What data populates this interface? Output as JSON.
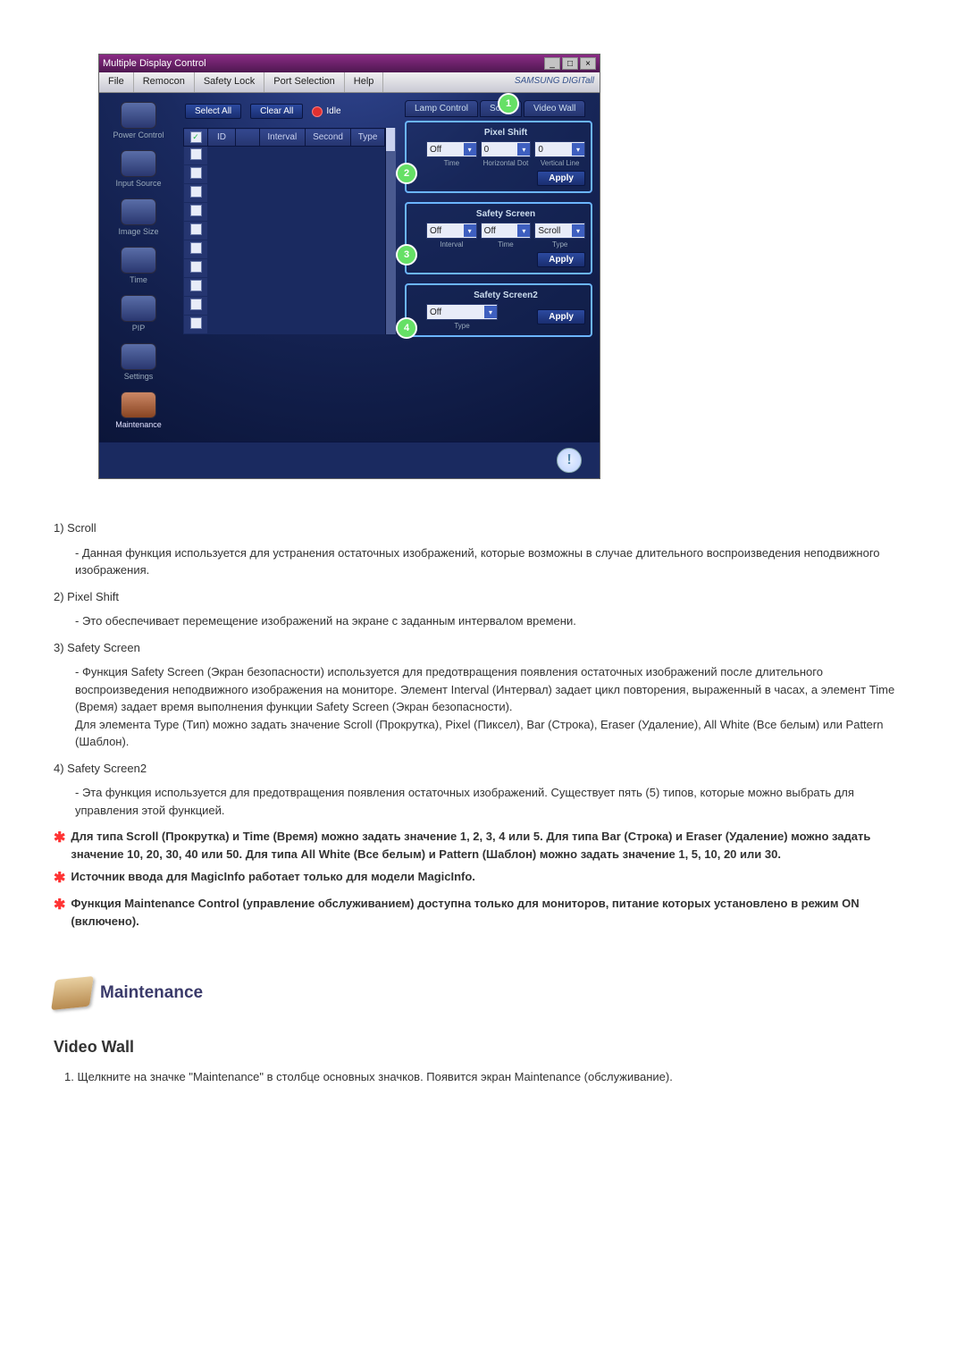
{
  "app": {
    "window_title": "Multiple Display Control",
    "menu": [
      "File",
      "Remocon",
      "Safety Lock",
      "Port Selection",
      "Help"
    ],
    "brand": "SAMSUNG DIGITall",
    "sidebar": [
      {
        "label": "Power Control"
      },
      {
        "label": "Input Source"
      },
      {
        "label": "Image Size"
      },
      {
        "label": "Time"
      },
      {
        "label": "PIP"
      },
      {
        "label": "Settings"
      },
      {
        "label": "Maintenance",
        "active": true
      }
    ],
    "top_buttons": {
      "select_all": "Select All",
      "clear_all": "Clear All",
      "idle": "Idle"
    },
    "table_headers": [
      "",
      "ID",
      "",
      "Interval",
      "Second",
      "Type"
    ],
    "right": {
      "tabs": [
        "Lamp Control",
        "Scroll",
        "Video Wall"
      ],
      "pixel_shift": {
        "title": "Pixel Shift",
        "time": {
          "val": "Off",
          "caption": "Time"
        },
        "hdot": {
          "val": "0",
          "caption": "Horizontal Dot"
        },
        "vline": {
          "val": "0",
          "caption": "Vertical Line"
        },
        "apply": "Apply"
      },
      "safety_screen": {
        "title": "Safety Screen",
        "interval": {
          "val": "Off",
          "caption": "Interval"
        },
        "time": {
          "val": "Off",
          "caption": "Time"
        },
        "type": {
          "val": "Scroll",
          "caption": "Type"
        },
        "apply": "Apply"
      },
      "safety_screen2": {
        "title": "Safety Screen2",
        "type": {
          "val": "Off",
          "caption": "Type"
        },
        "apply": "Apply"
      }
    }
  },
  "notes": {
    "n1_label": "1)  Scroll",
    "n1_desc": "-  Данная функция используется для устранения остаточных изображений, которые возможны в случае длительного воспроизведения неподвижного изображения.",
    "n2_label": "2)  Pixel Shift",
    "n2_desc": "-  Это обеспечивает перемещение изображений на экране с заданным интервалом времени.",
    "n3_label": "3)  Safety Screen",
    "n3_desc": "-  Функция Safety Screen (Экран безопасности) используется для предотвращения появления остаточных изображений после длительного воспроизведения неподвижного изображения на мониторе. Элемент Interval (Интервал) задает цикл повторения, выраженный в часах, а элемент Time (Время) задает время выполнения функции Safety Screen (Экран безопасности).\nДля элемента Type (Тип) можно задать значение Scroll (Прокрутка), Pixel (Пиксел), Bar (Строка), Eraser (Удаление), All White (Все белым) или Pattern (Шаблон).",
    "n4_label": "4)  Safety Screen2",
    "n4_desc": "-  Эта функция используется для предотвращения появления остаточных изображений. Существует пять (5) типов, которые можно выбрать для управления этой функцией.",
    "s1": "Для типа Scroll (Прокрутка) и Time (Время) можно задать значение 1, 2, 3, 4 или 5. Для типа Bar (Строка) и Eraser (Удаление) можно задать значение 10, 20, 30, 40 или 50. Для типа All White (Все белым) и Pattern (Шаблон) можно задать значение 1, 5, 10, 20 или 30.",
    "s2": "Источник ввода для MagicInfo работает только для модели MagicInfo.",
    "s3": "Функция Maintenance Control (управление обслуживанием) доступна только для мониторов, питание которых установлено в режим ON (включено)."
  },
  "section": {
    "title": "Maintenance",
    "subtitle": "Video Wall",
    "step1": "1.  Щелкните на значке \"Maintenance\" в столбце основных значков. Появится экран Maintenance (обслуживание)."
  }
}
